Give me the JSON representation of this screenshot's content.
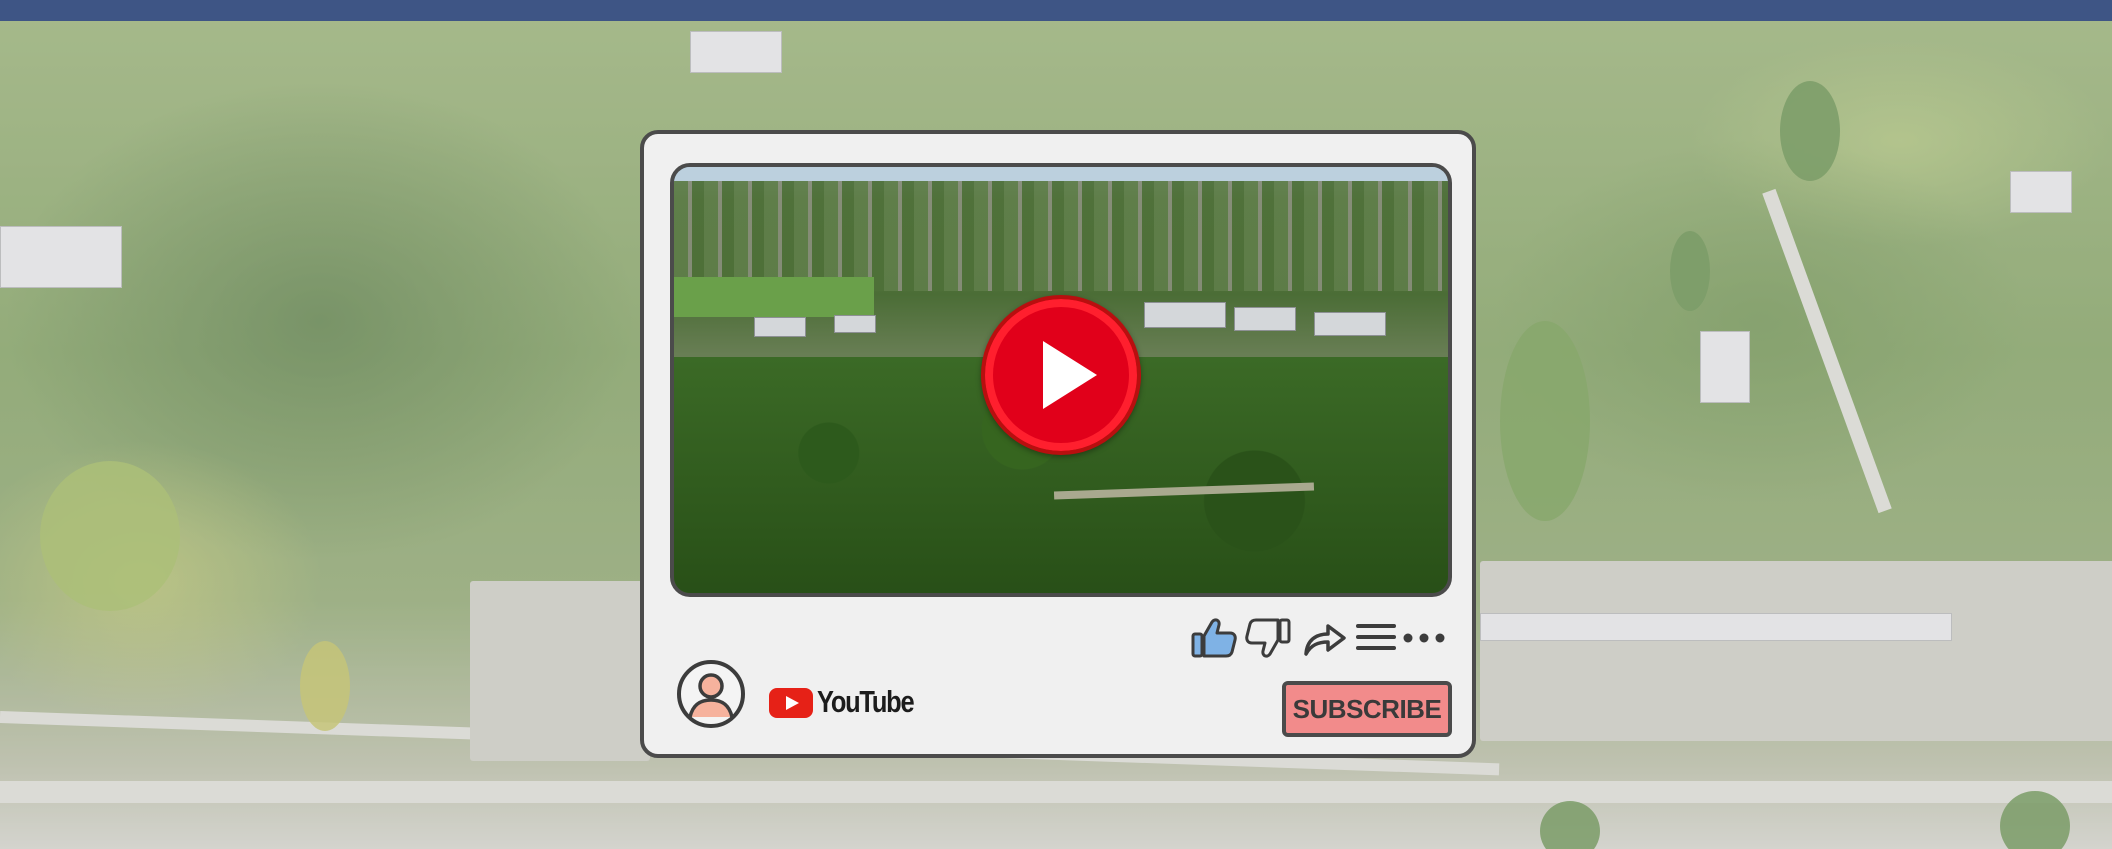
{
  "colors": {
    "top_bar": "#3e5585",
    "card_background": "#f0f0f0",
    "card_border": "#4b4b4b",
    "play_button_red": "#e1001a",
    "youtube_red": "#e62117",
    "subscribe_background": "#f28b8b",
    "like_icon_fill": "#7fb2e5"
  },
  "player": {
    "play_button_icon": "play-icon",
    "actions": [
      {
        "name": "like",
        "icon": "thumbs-up-icon"
      },
      {
        "name": "dislike",
        "icon": "thumbs-down-icon"
      },
      {
        "name": "share",
        "icon": "share-arrow-icon"
      },
      {
        "name": "playlist",
        "icon": "menu-lines-icon"
      },
      {
        "name": "more",
        "icon": "more-dots-icon"
      }
    ]
  },
  "channel": {
    "avatar_icon": "user-avatar-icon",
    "logo_icon": "youtube-logo-icon",
    "logo_text": "YouTube"
  },
  "subscribe_button": {
    "label": "SUBSCRIBE"
  }
}
